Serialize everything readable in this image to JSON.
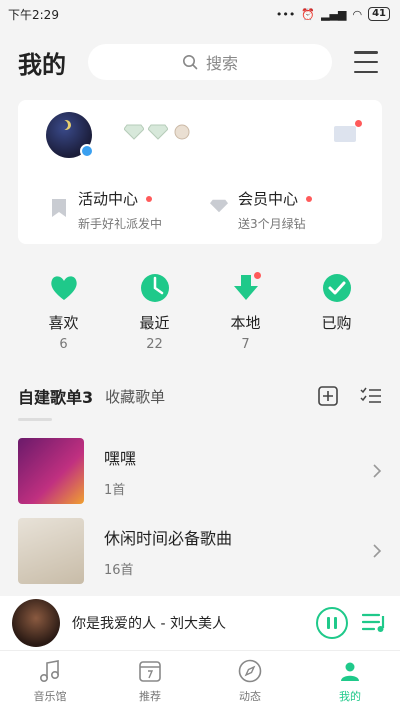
{
  "statusbar": {
    "time": "下午2:29",
    "battery": "41"
  },
  "header": {
    "title": "我的",
    "search_placeholder": "搜索"
  },
  "profile": {
    "promos": [
      {
        "title": "活动中心",
        "subtitle": "新手好礼派发中"
      },
      {
        "title": "会员中心",
        "subtitle": "送3个月绿钻"
      }
    ]
  },
  "quick": [
    {
      "label": "喜欢",
      "count": "6",
      "icon": "heart-icon"
    },
    {
      "label": "最近",
      "count": "22",
      "icon": "clock-icon"
    },
    {
      "label": "本地",
      "count": "7",
      "icon": "download-icon"
    },
    {
      "label": "已购",
      "count": "",
      "icon": "check-icon"
    }
  ],
  "playlists": {
    "tab_created": "自建歌单3",
    "tab_collected": "收藏歌单",
    "items": [
      {
        "title": "嘿嘿",
        "count": "1首"
      },
      {
        "title": "休闲时间必备歌曲",
        "count": "16首"
      }
    ]
  },
  "player": {
    "now_playing": "你是我爱的人 - 刘大美人"
  },
  "nav": [
    {
      "label": "音乐馆",
      "icon": "music-note-icon"
    },
    {
      "label": "推荐",
      "icon": "calendar-icon"
    },
    {
      "label": "动态",
      "icon": "compass-icon"
    },
    {
      "label": "我的",
      "icon": "profile-icon"
    }
  ],
  "colors": {
    "accent": "#1fc98a",
    "badge": "#ff5a5a"
  }
}
